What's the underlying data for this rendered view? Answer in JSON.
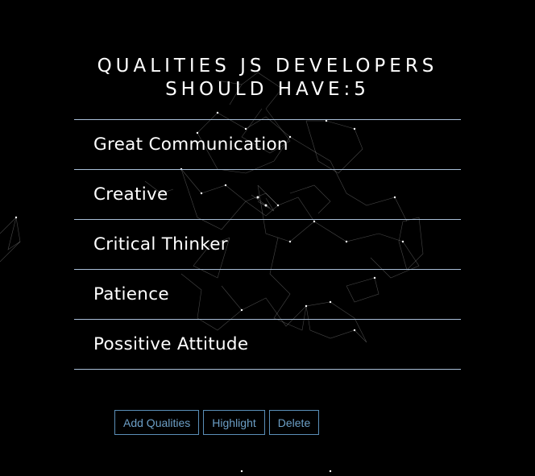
{
  "title_line1": "QUALITIES JS DEVELOPERS",
  "title_line2": "SHOULD HAVE:5",
  "qualities": [
    "Great Communication",
    "Creative",
    "Critical Thinker",
    "Patience",
    "Possitive Attitude"
  ],
  "buttons": {
    "add": "Add Qualities",
    "highlight": "Highlight",
    "delete": "Delete"
  },
  "colors": {
    "background": "#000000",
    "divider": "#a9bfd8",
    "button_accent": "#6c9fc6"
  }
}
